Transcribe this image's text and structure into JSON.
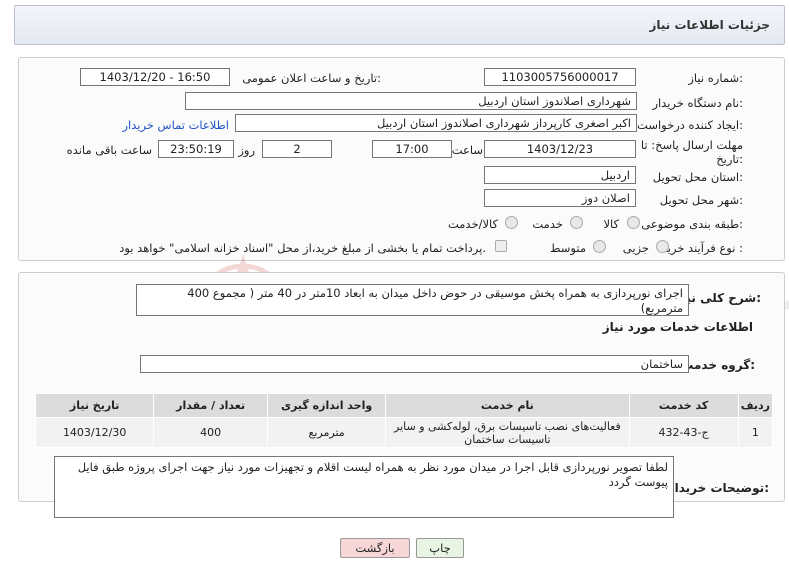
{
  "header": {
    "title": "جزئیات اطلاعات نیاز"
  },
  "form": {
    "need_number_label": "شماره نیاز:",
    "need_number": "1103005756000017",
    "announce_label": "تاریخ و ساعت اعلان عمومی:",
    "announce_value": "1403/12/20 - 16:50",
    "buyer_label": "نام دستگاه خریدار:",
    "buyer_value": "شهرداری اصلاندوز استان اردبیل",
    "requester_label": "ایجاد کننده درخواست:",
    "requester_value": "اکبر اصغری کارپرداز شهرداری اصلاندوز استان اردبیل",
    "contact_link": "اطلاعات تماس خریدار",
    "deadline_label_1": "مهلت ارسال پاسخ: تا",
    "deadline_label_2": "تاریخ:",
    "deadline_date": "1403/12/23",
    "time_label": "ساعت",
    "deadline_time": "17:00",
    "days_value": "2",
    "days_label": "روز و",
    "remaining_time": "23:50:19",
    "remaining_label": "ساعت باقی مانده",
    "province_label": "استان محل تحویل:",
    "province_value": "اردبیل",
    "city_label": "شهر محل تحویل:",
    "city_value": "اصلان دوز",
    "category_label": "طبقه بندی موضوعی:",
    "category_options": [
      "کالا",
      "خدمت",
      "کالا/خدمت"
    ],
    "process_label": "نوع فرآیند خرید :",
    "process_options": [
      "جزیی",
      "متوسط"
    ],
    "payment_note": "پرداخت تمام یا بخشی از مبلغ خرید،از محل \"اسناد خزانه اسلامی\" خواهد بود."
  },
  "details": {
    "summary_label": "شرح کلی نیاز:",
    "summary_value": "اجرای نورپردازی به همراه پخش موسیقی در حوض داخل میدان به ابعاد 10متر در 40 متر ( مجموع 400 مترمربع)",
    "services_title": "اطلاعات خدمات مورد نیاز",
    "group_label": "گروه خدمت:",
    "group_value": "ساختمان",
    "table_headers": [
      "ردیف",
      "کد خدمت",
      "نام خدمت",
      "واحد اندازه گیری",
      "تعداد / مقدار",
      "تاریخ نیاز"
    ],
    "rows": [
      {
        "row": "1",
        "code": "ج-43-432",
        "name": "فعالیت‌های نصب تاسیسات برق، لوله‌کشی و سایر تاسیسات ساختمان",
        "unit": "مترمربع",
        "qty": "400",
        "date": "1403/12/30"
      }
    ],
    "buyer_notes_label": "توضیحات خریدار:",
    "buyer_notes_value": "لطفا تصویر نورپردازی قابل اجرا در میدان مورد نظر  به همراه لیست اقلام و  تجهیزات مورد نیاز جهت اجرای پروژه طبق فایل پیوست گردد"
  },
  "buttons": {
    "print": "چاپ",
    "back": "بازگشت"
  },
  "watermark": "AriaTender.neT",
  "colors": {
    "link": "#2155c4",
    "back_bg": "#f6d6d6",
    "print_bg": "#e9f5e3"
  }
}
